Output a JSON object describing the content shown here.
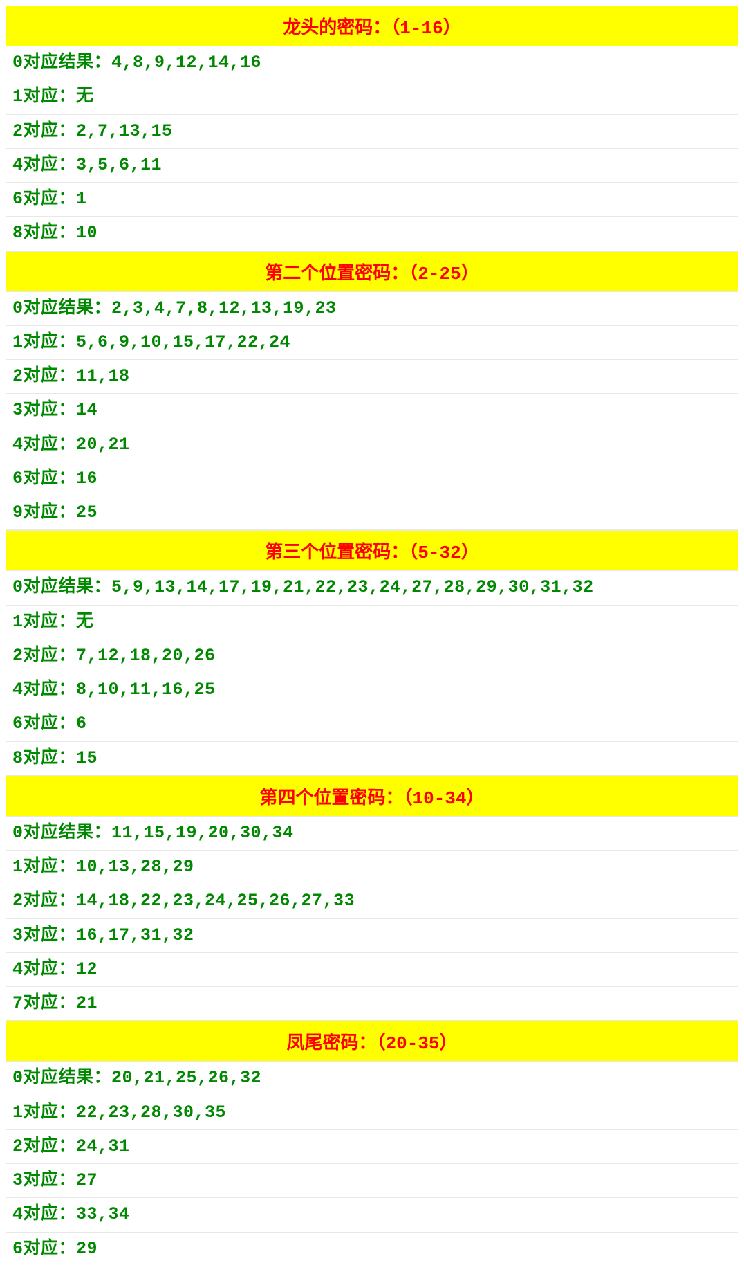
{
  "sections": [
    {
      "header": "龙头的密码：（1-16）",
      "rows": [
        "0对应结果：4,8,9,12,14,16",
        "1对应：无",
        "2对应：2,7,13,15",
        "4对应：3,5,6,11",
        "6对应：1",
        "8对应：10"
      ]
    },
    {
      "header": "第二个位置密码：（2-25）",
      "rows": [
        "0对应结果：2,3,4,7,8,12,13,19,23",
        "1对应：5,6,9,10,15,17,22,24",
        "2对应：11,18",
        "3对应：14",
        "4对应：20,21",
        "6对应：16",
        "9对应：25"
      ]
    },
    {
      "header": "第三个位置密码：（5-32）",
      "rows": [
        "0对应结果：5,9,13,14,17,19,21,22,23,24,27,28,29,30,31,32",
        "1对应：无",
        "2对应：7,12,18,20,26",
        "4对应：8,10,11,16,25",
        "6对应：6",
        "8对应：15"
      ]
    },
    {
      "header": "第四个位置密码：（10-34）",
      "rows": [
        "0对应结果：11,15,19,20,30,34",
        "1对应：10,13,28,29",
        "2对应：14,18,22,23,24,25,26,27,33",
        "3对应：16,17,31,32",
        "4对应：12",
        "7对应：21"
      ]
    },
    {
      "header": "凤尾密码：（20-35）",
      "rows": [
        "0对应结果：20,21,25,26,32",
        "1对应：22,23,28,30,35",
        "2对应：24,31",
        "3对应：27",
        "4对应：33,34",
        "6对应：29"
      ]
    }
  ]
}
